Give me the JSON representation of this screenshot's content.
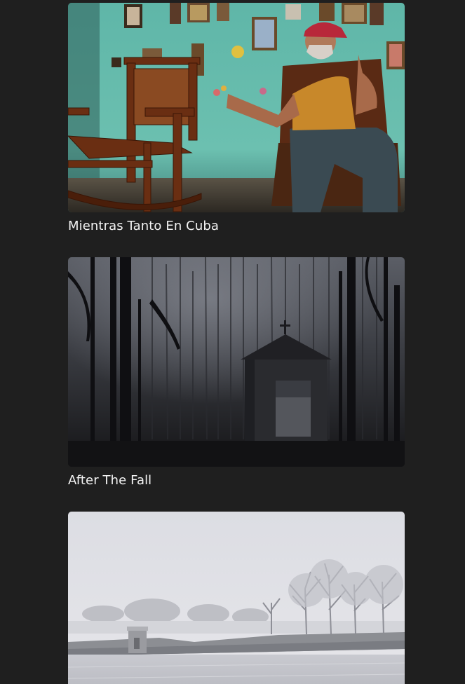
{
  "feed": {
    "items": [
      {
        "title": "Mientras Tanto En Cuba",
        "image": "old-man-in-rocking-chair-photo"
      },
      {
        "title": "After The Fall",
        "image": "burnt-forest-chapel-photo"
      },
      {
        "title": "",
        "image": "frosty-field-trees-photo"
      }
    ]
  },
  "colors": {
    "background": "#1f1f1f",
    "title_text": "#f4f4f4"
  }
}
